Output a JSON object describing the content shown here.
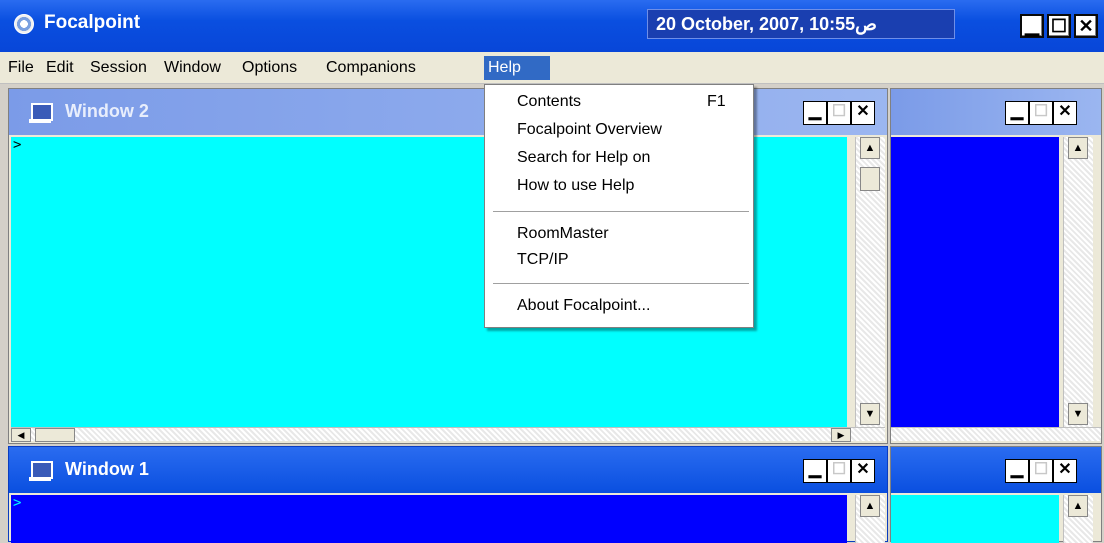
{
  "app": {
    "title": "Focalpoint",
    "datetime": "20 October, 2007, ص10:55"
  },
  "menu": [
    "File",
    "Edit",
    "Session",
    "Window",
    "Options",
    "Companions",
    "Help"
  ],
  "help_menu": {
    "contents": "Contents",
    "contents_shortcut": "F1",
    "overview": "Focalpoint Overview",
    "search": "Search for Help on",
    "howto": "How to use Help",
    "roommaster": "RoomMaster",
    "tcpip": "TCP/IP",
    "about": "About Focalpoint..."
  },
  "windows": {
    "w2_title": "Window 2",
    "w1_title": "Window 1",
    "prompt": ">"
  },
  "colors": {
    "cyan": "#00ffff",
    "blue": "#0000ff",
    "title_active": "#0a4fe0",
    "title_inactive": "#7b9be8"
  },
  "icons": [
    "globe-icon",
    "computer-icon",
    "minimize-icon",
    "maximize-icon",
    "close-icon",
    "scroll-up-icon",
    "scroll-down-icon",
    "scroll-left-icon",
    "scroll-right-icon"
  ]
}
